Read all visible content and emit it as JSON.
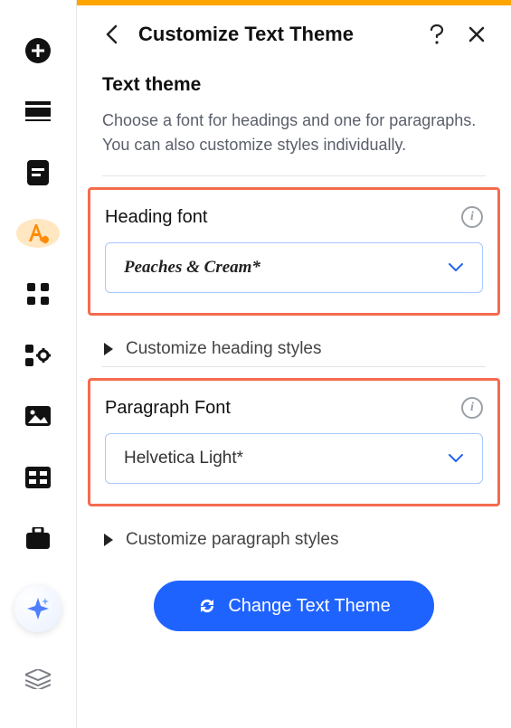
{
  "header": {
    "title": "Customize Text Theme"
  },
  "intro": {
    "title": "Text theme",
    "description": "Choose a font for headings and one for paragraphs. You can also customize styles individually."
  },
  "heading_font": {
    "label": "Heading font",
    "value": "Peaches & Cream*",
    "expand_label": "Customize heading styles"
  },
  "paragraph_font": {
    "label": "Paragraph Font",
    "value": "Helvetica Light*",
    "expand_label": "Customize paragraph styles"
  },
  "cta_label": "Change Text Theme"
}
